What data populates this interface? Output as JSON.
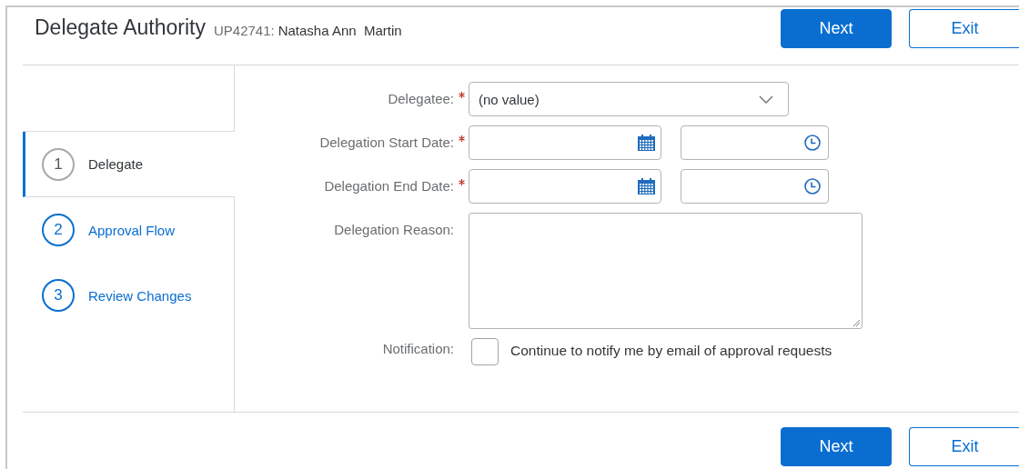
{
  "header": {
    "title": "Delegate Authority",
    "user_id": "UP42741:",
    "user_name": "Natasha Ann  Martin"
  },
  "header_buttons": [
    {
      "label": "Next",
      "kind": "primary"
    },
    {
      "label": "Exit",
      "kind": "secondary"
    }
  ],
  "steps": [
    {
      "number": "1",
      "label": "Delegate",
      "selected": true
    },
    {
      "number": "2",
      "label": "Approval Flow",
      "selected": false
    },
    {
      "number": "3",
      "label": "Review Changes",
      "selected": false
    }
  ],
  "form": [
    {
      "kind": "select",
      "label": "Delegatee:",
      "required": true,
      "value": "(no value)"
    },
    {
      "kind": "datetime",
      "label": "Delegation Start Date:",
      "required": true
    },
    {
      "kind": "datetime",
      "label": "Delegation End Date:",
      "required": true
    },
    {
      "kind": "textarea",
      "label": "Delegation Reason:",
      "required": false
    },
    {
      "kind": "checkbox",
      "label": "Notification:",
      "required": false,
      "checked": false,
      "text": "Continue to notify me by email of approval requests"
    }
  ],
  "footer_buttons": [
    {
      "label": "Next",
      "kind": "primary"
    },
    {
      "label": "Exit",
      "kind": "secondary"
    }
  ]
}
